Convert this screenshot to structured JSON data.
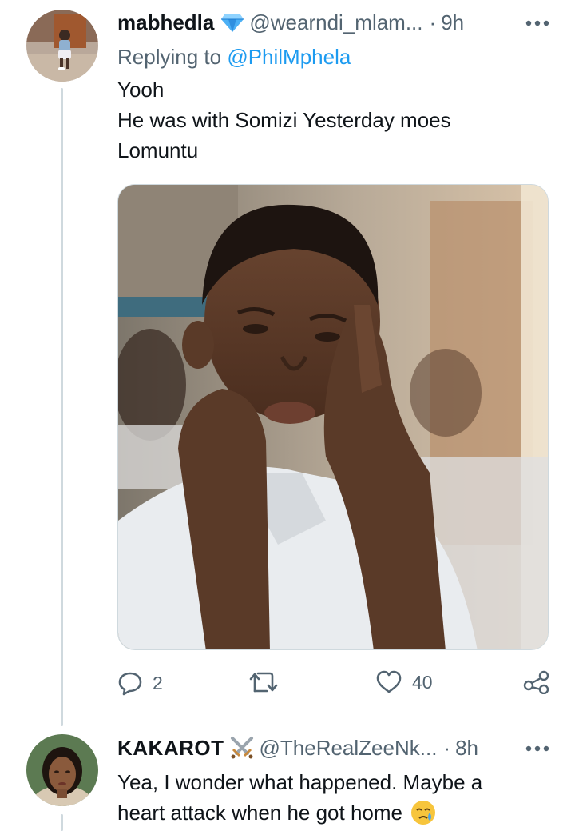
{
  "tweets": [
    {
      "display_name": "mabhedla",
      "badge_icon": "diamond-icon",
      "handle": "@wearndi_mlam...",
      "separator": "·",
      "time": "9h",
      "replying_prefix": "Replying to",
      "replying_to": "@PhilMphela",
      "text_lines": [
        "Yooh",
        "He was with Somizi Yesterday moes",
        "Lomuntu"
      ],
      "actions": {
        "replies": "2",
        "retweets": "",
        "likes": "40"
      }
    },
    {
      "display_name": "KAKAROT",
      "badge_icon": "crossed-swords-icon",
      "handle": "@TheRealZeeNk...",
      "separator": "·",
      "time": "8h",
      "text_lines": [
        "Yea, I wonder what happened. Maybe a",
        "heart attack when he got home"
      ],
      "emoji_icon": "crying-face-emoji-icon"
    }
  ],
  "colors": {
    "link": "#1d9bf0",
    "secondary": "#536471",
    "badge": "#1d9bf0"
  }
}
